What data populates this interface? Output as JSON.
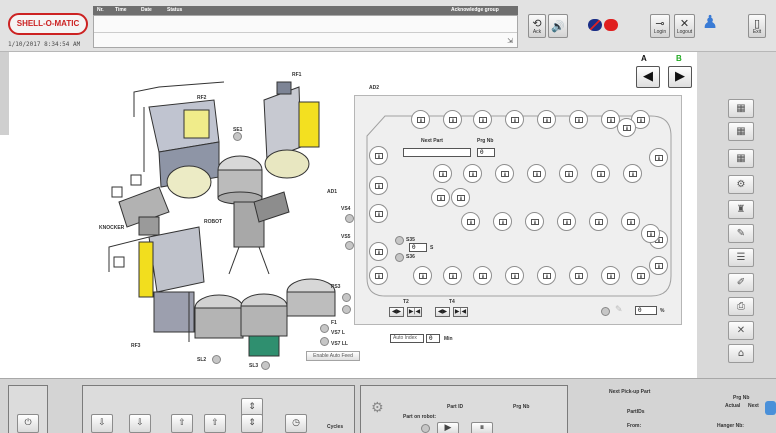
{
  "header": {
    "logo": "SHELL-O-MATIC",
    "datetime": "1/10/2017 8:34:54 AM",
    "alarm_columns": {
      "no": "Nr.",
      "time": "Time",
      "date": "Date",
      "status": "Status",
      "acknowledge_group": "Acknowledge group"
    },
    "buttons": {
      "ack_label": "Ack",
      "login_label": "Login",
      "logout_label": "Logout",
      "exit_label": "Exit"
    }
  },
  "nav": {
    "a_label": "A",
    "b_label": "B",
    "b_color": "#22aa22",
    "prev_glyph": "◀",
    "next_glyph": "▶"
  },
  "machine": {
    "rf1": "RF1",
    "rf2": "RF2",
    "rf3": "RF3",
    "se1": "SE1",
    "ad1": "AD1",
    "ad2": "AD2",
    "robot": "ROBOT",
    "knocker": "KNOCKER",
    "vs4": "VS4",
    "vs5": "VS5",
    "ps3": "PS3",
    "f1": "F1",
    "vs7l": "VS7 L",
    "vs7ll": "VS7 LL",
    "sl2": "SL2",
    "sl3": "SL3",
    "enable_auto_feed": "Enable Auto Feed",
    "auto_index_label": "Auto Index",
    "auto_index_value": "0",
    "auto_index_unit": "Min"
  },
  "loop": {
    "slot_value": "0",
    "next_part_label": "Next Part",
    "prg_nb_label": "Prg Nb",
    "prg_nb_value": "0",
    "s35": "S35",
    "s36": "S36",
    "s_field_value": "0",
    "s_field_suffix": "S",
    "t2": "T2",
    "t4": "T4",
    "percent_value": "0",
    "percent_unit": "%"
  },
  "bottom": {
    "cycles_label": "Cycles",
    "part_id_label": "Part ID",
    "prg_nb_label": "Prg Nb",
    "part_on_robot_label": "Part on robot:",
    "next_pickup_label": "Next Pick-up Part",
    "pickup_prg_nb_label": "Prg Nb",
    "actual_label": "Actual",
    "next_label": "Next",
    "part_ids_label": "PartIDs",
    "from_label": "From:",
    "hanger_nb_label": "Hanger Nb:"
  }
}
